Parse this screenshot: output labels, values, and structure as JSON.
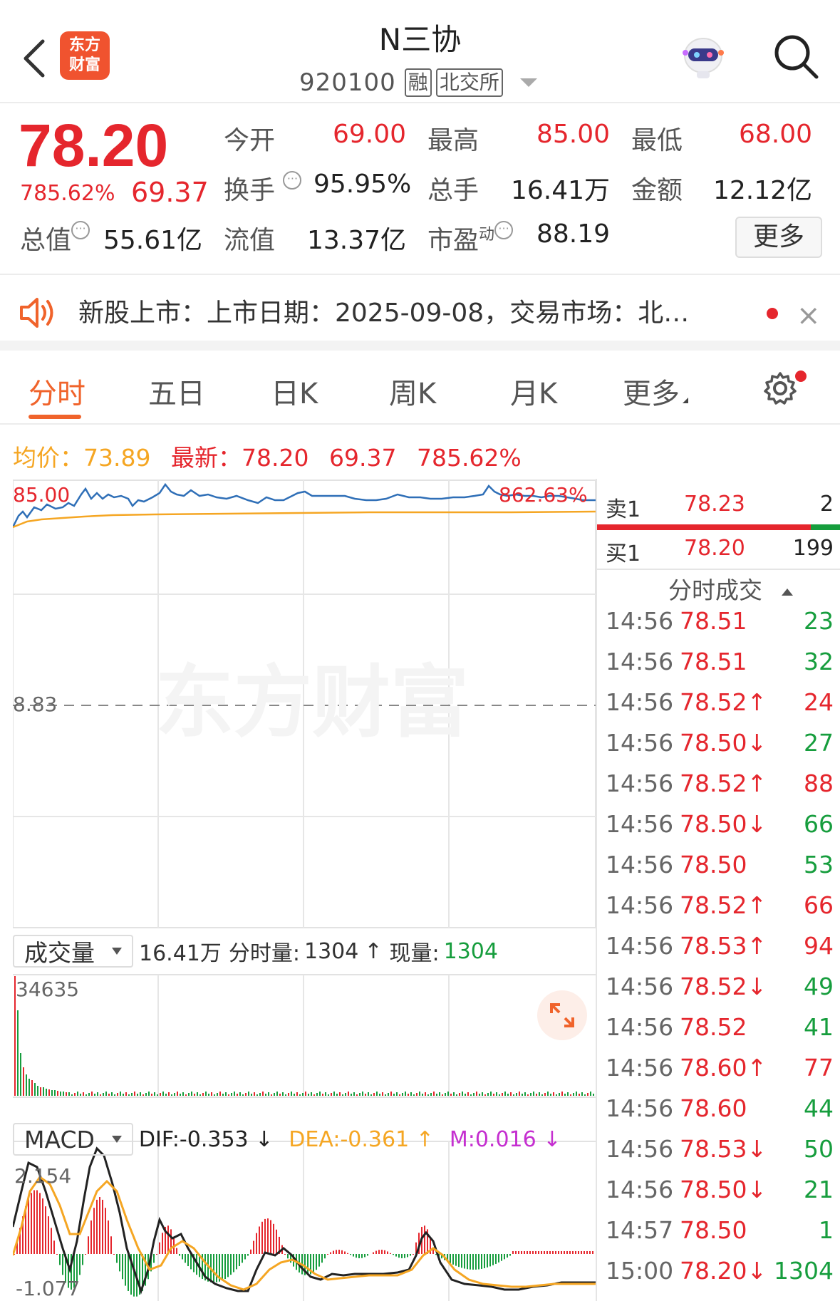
{
  "header": {
    "logo_line1": "东方",
    "logo_line2": "财富",
    "stock_name": "N三协",
    "code": "920100",
    "tag_margin": "融",
    "tag_exchange": "北交所"
  },
  "quote": {
    "price": "78.20",
    "change_pct": "785.62%",
    "change": "69.37",
    "open_label": "今开",
    "open": "69.00",
    "high_label": "最高",
    "high": "85.00",
    "low_label": "最低",
    "low": "68.00",
    "turnover_label": "换手",
    "turnover": "95.95%",
    "volume_label": "总手",
    "volume": "16.41万",
    "amount_label": "金额",
    "amount": "12.12亿",
    "mktcap_label": "总值",
    "mktcap": "55.61亿",
    "float_label": "流值",
    "float": "13.37亿",
    "pe_label": "市盈",
    "pe_sup": "动",
    "pe": "88.19",
    "more_label": "更多"
  },
  "notice": {
    "text": "新股上市：上市日期：2025-09-08，交易市场：北…",
    "close": "×"
  },
  "tabs": [
    {
      "label": "分时",
      "active": true
    },
    {
      "label": "五日"
    },
    {
      "label": "日K"
    },
    {
      "label": "周K"
    },
    {
      "label": "月K"
    },
    {
      "label": "更多"
    }
  ],
  "legend": {
    "avg_label": "均价：",
    "avg": "73.89",
    "latest_label": "最新：",
    "latest": "78.20",
    "change": "69.37",
    "change_pct": "785.62%"
  },
  "chart_labels": {
    "top_price": "85.00",
    "top_pct": "862.63%",
    "mid_price": "8.83",
    "vol_max": "34635",
    "macd_max": "2.154",
    "macd_min": "-1.077",
    "watermark": "东方财富"
  },
  "volume_header": {
    "selector": "成交量",
    "total": "16.41万",
    "tick_label": "分时量:",
    "tick": "1304",
    "tick_arrow": "↑",
    "now_label": "现量:",
    "now": "1304"
  },
  "macd_header": {
    "selector": "MACD",
    "dif": "DIF:-0.353 ↓",
    "dea": "DEA:-0.361 ↑",
    "m": "M:0.016 ↓"
  },
  "book": {
    "sell_label": "卖1",
    "sell_price": "78.23",
    "sell_vol": "2",
    "buy_label": "买1",
    "buy_price": "78.20",
    "buy_vol": "199",
    "ticks_title": "分时成交",
    "ticks": [
      {
        "time": "14:56",
        "price": "78.51",
        "vol": "23",
        "color": "green"
      },
      {
        "time": "14:56",
        "price": "78.51",
        "vol": "32",
        "color": "green"
      },
      {
        "time": "14:56",
        "price": "78.52↑",
        "vol": "24",
        "color": "red"
      },
      {
        "time": "14:56",
        "price": "78.50↓",
        "vol": "27",
        "color": "green"
      },
      {
        "time": "14:56",
        "price": "78.52↑",
        "vol": "88",
        "color": "red"
      },
      {
        "time": "14:56",
        "price": "78.50↓",
        "vol": "66",
        "color": "green"
      },
      {
        "time": "14:56",
        "price": "78.50",
        "vol": "53",
        "color": "green"
      },
      {
        "time": "14:56",
        "price": "78.52↑",
        "vol": "66",
        "color": "red"
      },
      {
        "time": "14:56",
        "price": "78.53↑",
        "vol": "94",
        "color": "red"
      },
      {
        "time": "14:56",
        "price": "78.52↓",
        "vol": "49",
        "color": "green"
      },
      {
        "time": "14:56",
        "price": "78.52",
        "vol": "41",
        "color": "green"
      },
      {
        "time": "14:56",
        "price": "78.60↑",
        "vol": "77",
        "color": "red"
      },
      {
        "time": "14:56",
        "price": "78.60",
        "vol": "44",
        "color": "green"
      },
      {
        "time": "14:56",
        "price": "78.53↓",
        "vol": "50",
        "color": "green"
      },
      {
        "time": "14:56",
        "price": "78.50↓",
        "vol": "21",
        "color": "green"
      },
      {
        "time": "14:57",
        "price": "78.50",
        "vol": "1",
        "color": "green"
      },
      {
        "time": "15:00",
        "price": "78.20↓",
        "vol": "1304",
        "color": "green"
      }
    ]
  },
  "colors": {
    "up": "#e5262d",
    "down": "#169d3d",
    "avg_line": "#f5a623",
    "price_line": "#2f6fb7",
    "accent": "#f0632b"
  }
}
